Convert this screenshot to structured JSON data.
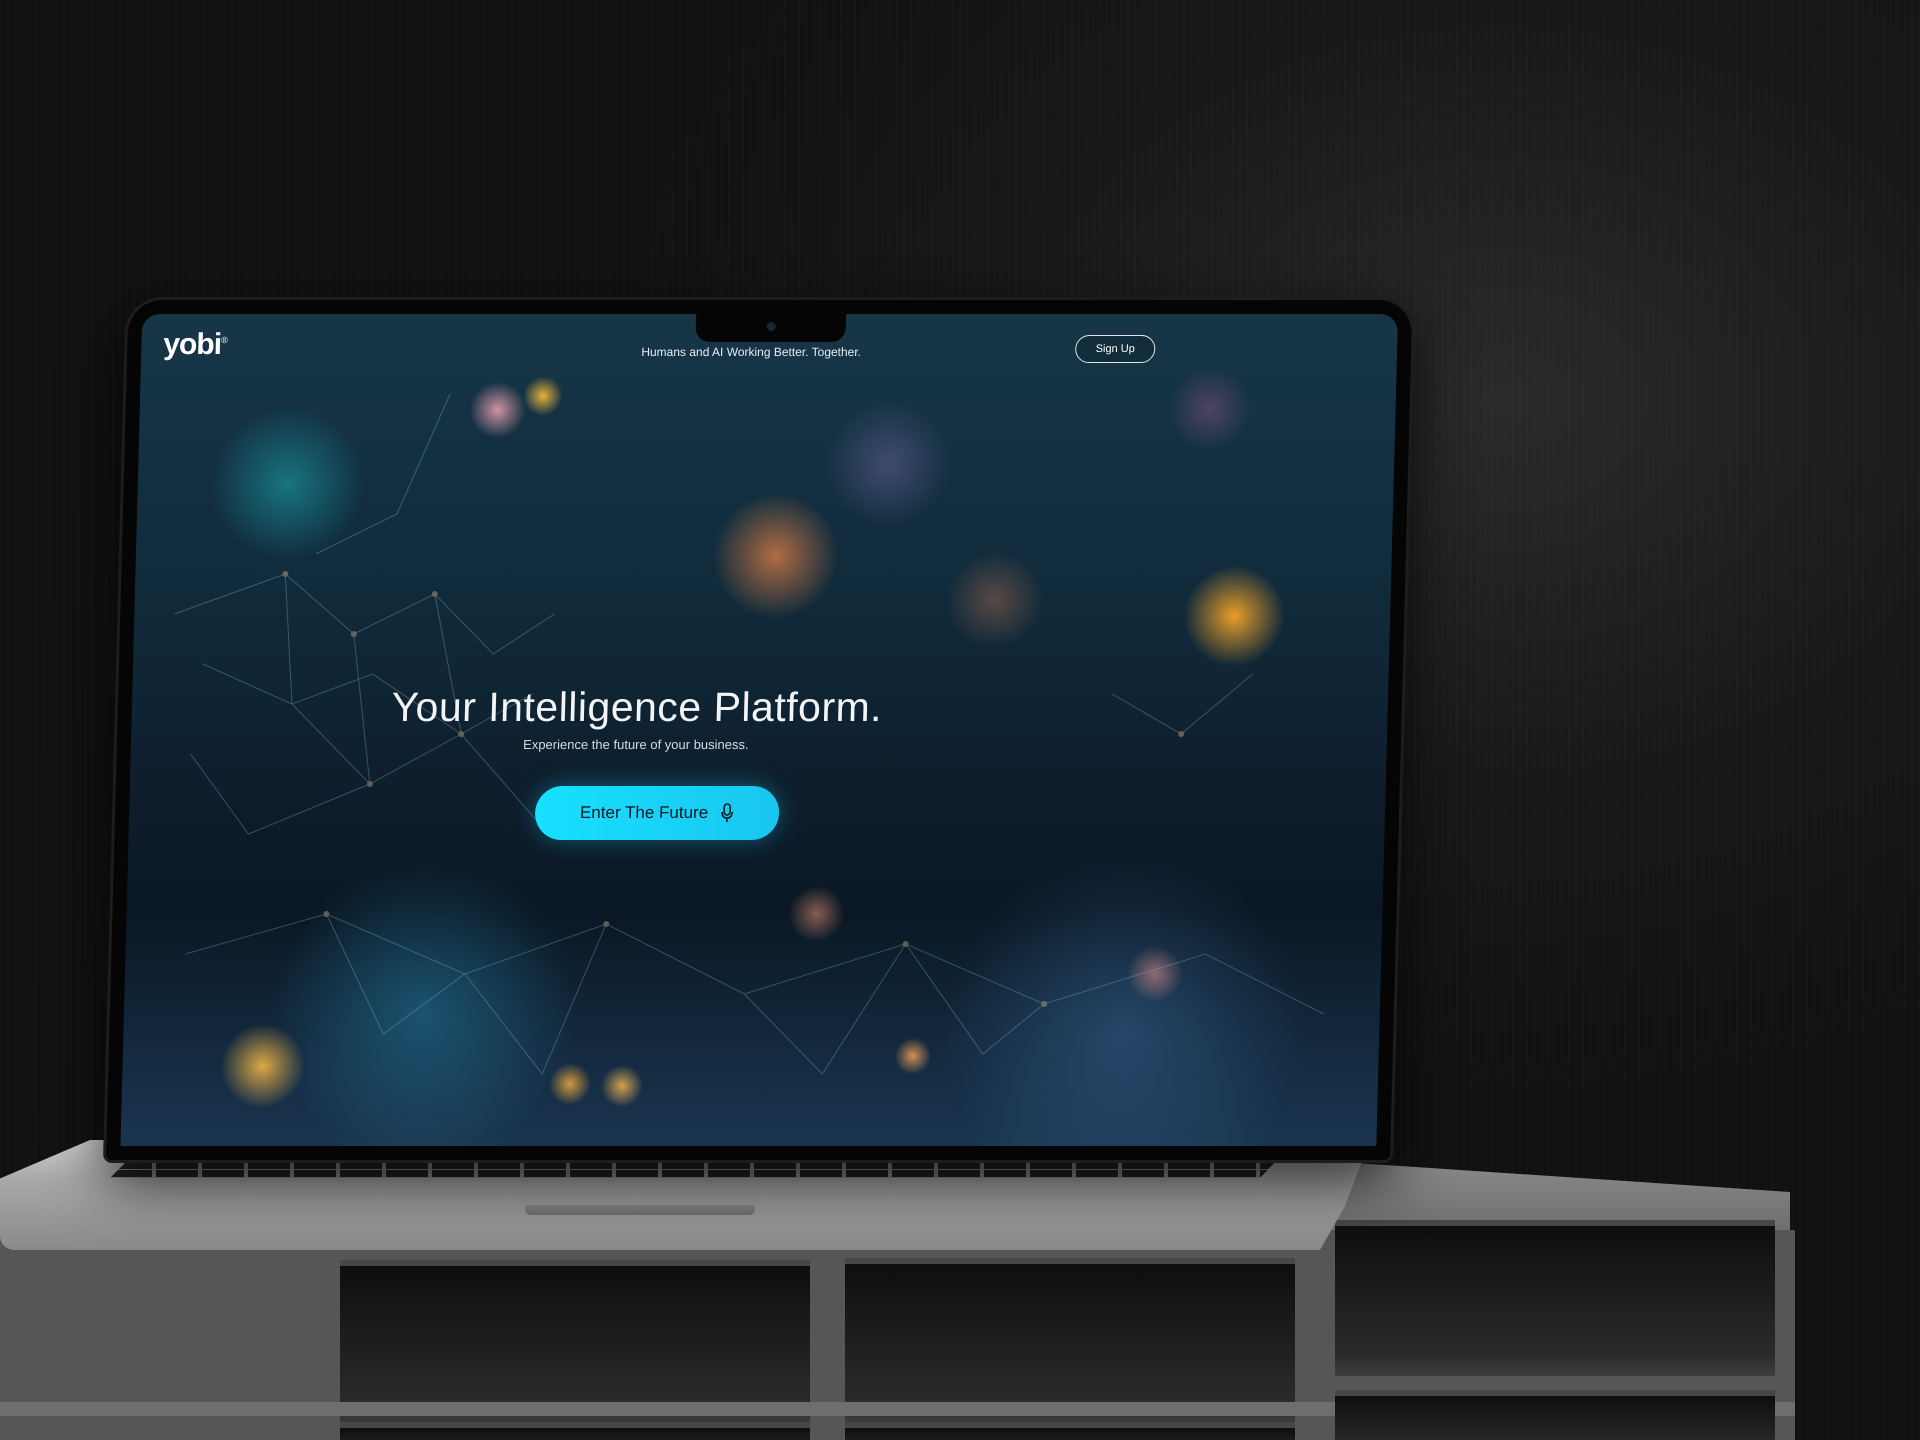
{
  "header": {
    "logo_text": "yobi",
    "logo_mark": "®",
    "tagline": "Humans and AI Working Better. Together.",
    "signup_label": "Sign Up"
  },
  "hero": {
    "title": "Your Intelligence Platform.",
    "subtitle": "Experience the future of your business.",
    "cta_label": "Enter The Future",
    "cta_icon": "microphone-icon"
  },
  "colors": {
    "accent": "#18e0ff",
    "background": "#161616",
    "screen_bg": "#102a3a",
    "text_primary": "#f2f4f5"
  }
}
